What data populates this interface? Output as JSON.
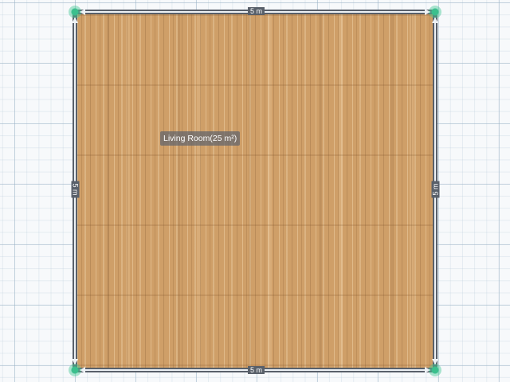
{
  "room": {
    "label": "Living Room(25 m²)",
    "floor_color": "#cf9f68"
  },
  "dimensions": {
    "top": "5 m",
    "bottom": "5 m",
    "left": "5 m",
    "right": "5 m"
  },
  "colors": {
    "wall": "#59606a",
    "corner_handle": "#3bbf8d",
    "grid_background": "#f7f9fb"
  },
  "icons": {
    "corner_handle": "corner-handle-icon",
    "dimension_arrow": "arrow-icon"
  }
}
